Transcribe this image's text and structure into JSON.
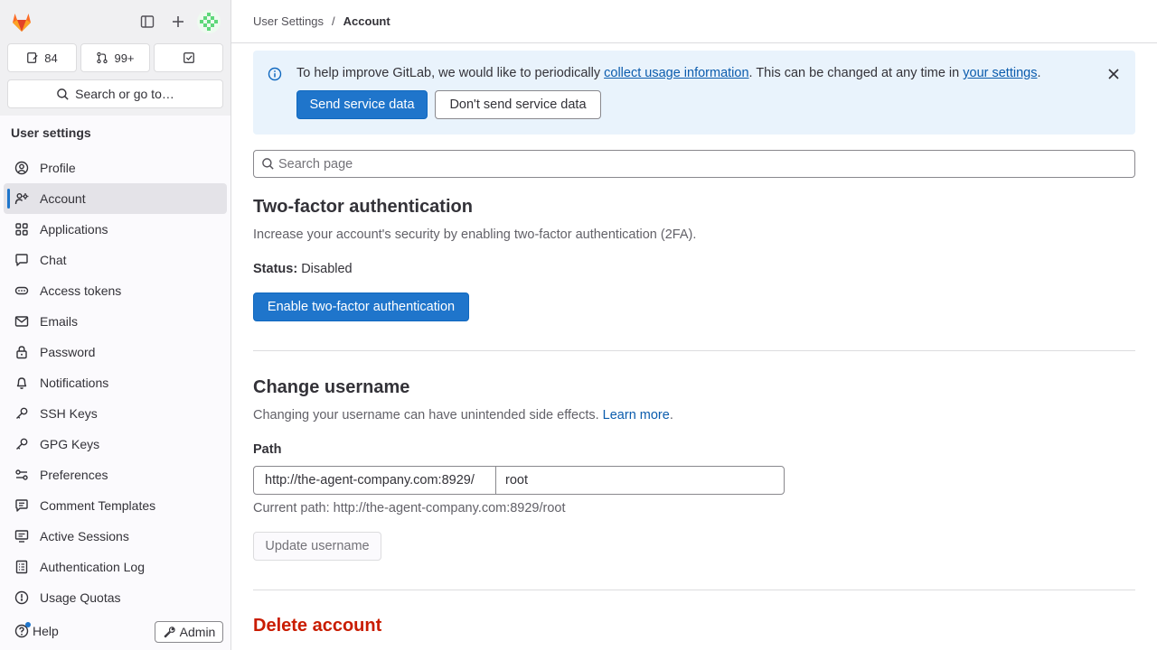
{
  "sidebar": {
    "counters": {
      "issues": "84",
      "merge_requests": "99+"
    },
    "search_label": "Search or go to…",
    "heading": "User settings",
    "items": [
      {
        "label": "Profile"
      },
      {
        "label": "Account"
      },
      {
        "label": "Applications"
      },
      {
        "label": "Chat"
      },
      {
        "label": "Access tokens"
      },
      {
        "label": "Emails"
      },
      {
        "label": "Password"
      },
      {
        "label": "Notifications"
      },
      {
        "label": "SSH Keys"
      },
      {
        "label": "GPG Keys"
      },
      {
        "label": "Preferences"
      },
      {
        "label": "Comment Templates"
      },
      {
        "label": "Active Sessions"
      },
      {
        "label": "Authentication Log"
      },
      {
        "label": "Usage Quotas"
      }
    ],
    "help_label": "Help",
    "admin_label": "Admin"
  },
  "breadcrumb": {
    "parent": "User Settings",
    "separator": "/",
    "current": "Account"
  },
  "alert": {
    "text_before": "To help improve GitLab, we would like to periodically ",
    "link1": "collect usage information",
    "text_middle": ". This can be changed at any time in ",
    "link2": "your settings",
    "text_after": ".",
    "send_button": "Send service data",
    "dont_send_button": "Don't send service data"
  },
  "search": {
    "placeholder": "Search page"
  },
  "two_factor": {
    "title": "Two-factor authentication",
    "description": "Increase your account's security by enabling two-factor authentication (2FA).",
    "status_label": "Status:",
    "status_value": "Disabled",
    "enable_button": "Enable two-factor authentication"
  },
  "change_username": {
    "title": "Change username",
    "description": "Changing your username can have unintended side effects. ",
    "learn_more": "Learn more",
    "description_end": ".",
    "path_label": "Path",
    "path_prefix": "http://the-agent-company.com:8929/",
    "path_value": "root",
    "current_path": "Current path: http://the-agent-company.com:8929/root",
    "update_button": "Update username"
  },
  "delete_account": {
    "title": "Delete account"
  },
  "colors": {
    "primary": "#1f75cb",
    "danger": "#c91c00",
    "alert_bg": "#e9f3fc",
    "link": "#0b5cad"
  }
}
